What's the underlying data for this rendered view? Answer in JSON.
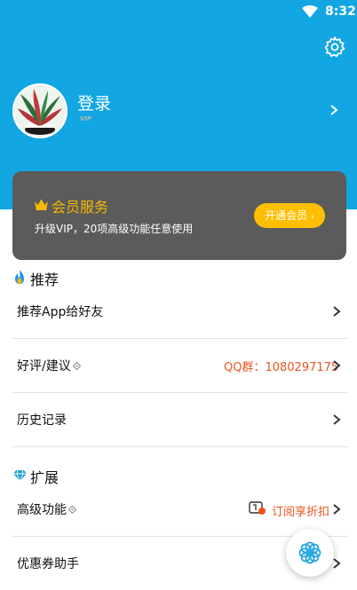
{
  "status_bar": {
    "time": "8:32"
  },
  "profile": {
    "login_label": "登录",
    "vip_badge": "VIP"
  },
  "vip_card": {
    "title": "会员服务",
    "subtitle": "升级VIP，20项高级功能任意使用",
    "button_label": "开通会员",
    "title_color": "#f5b800",
    "button_color": "#ffbf00"
  },
  "sections": {
    "recommend": {
      "title": "推荐"
    },
    "extend": {
      "title": "扩展"
    }
  },
  "rows": {
    "recommend_app": {
      "label": "推荐App给好友"
    },
    "feedback": {
      "label": "好评/建议",
      "right_text": "QQ群：1080297175"
    },
    "history": {
      "label": "历史记录"
    },
    "advanced": {
      "label": "高级功能",
      "right_text": "订阅享折扣"
    },
    "coupon": {
      "label": "优惠券助手"
    }
  },
  "colors": {
    "header": "#12a6e2",
    "accent_orange": "#e8541e"
  },
  "icons": [
    "wifi-icon",
    "gear-icon",
    "chevron-right-icon",
    "crown-icon",
    "flame-icon",
    "diamond-icon",
    "info-icon",
    "coupon-tag-icon",
    "flower-icon"
  ]
}
